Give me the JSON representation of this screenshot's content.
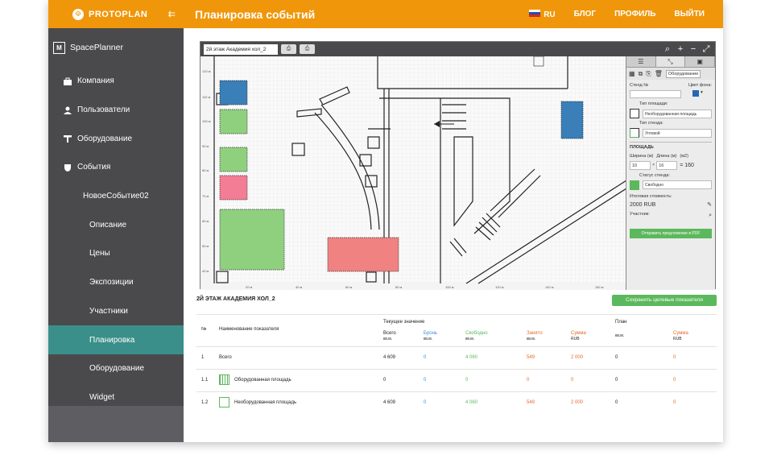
{
  "app": {
    "brand": "PROTOPLAN",
    "collapse_icon": "collapse-arrow-icon",
    "product": "SpacePlanner",
    "product_mark": "M",
    "page_title": "Планировка событий"
  },
  "topnav": {
    "lang": "RU",
    "blog": "БЛОГ",
    "profile": "ПРОФИЛЬ",
    "logout": "ВЫЙТИ"
  },
  "sidebar": {
    "items": [
      {
        "label": "Компания",
        "icon": "briefcase-icon"
      },
      {
        "label": "Пользователи",
        "icon": "user-icon"
      },
      {
        "label": "Оборудование",
        "icon": "tool-icon"
      },
      {
        "label": "События",
        "icon": "shield-icon"
      },
      {
        "label": "НовоеСобытие02"
      },
      {
        "label": "Описание"
      },
      {
        "label": "Цены"
      },
      {
        "label": "Экспозиции"
      },
      {
        "label": "Участники"
      },
      {
        "label": "Планировка",
        "active": true
      },
      {
        "label": "Оборудование"
      },
      {
        "label": "Widget"
      }
    ]
  },
  "planner": {
    "floor_select": "2й этаж Академия хол_2",
    "y_ticks": [
      "120 м",
      "110 м",
      "100 м",
      "90 м",
      "80 м",
      "70 м",
      "60 м",
      "50 м",
      "40 м",
      "30 м"
    ],
    "x_ticks": [
      "20 м",
      "40 м",
      "60 м",
      "80 м",
      "100 м",
      "120 м",
      "140 м",
      "160 м"
    ],
    "panel": {
      "tab_equipment": "Оборудование",
      "stand_label": "Стенд №",
      "bg_color_label": "Цвет фона:",
      "area_type_label": "Тип площади:",
      "area_type_value": "Необорудованная площадь",
      "stand_type_label": "Тип стенда:",
      "stand_type_value": "Угловой",
      "area_section": "ПЛОЩАДЬ",
      "width_label": "Ширина (м)",
      "length_label": "Длина (м)",
      "m2_label": "(м2)",
      "width_value": "10",
      "length_value": "16",
      "area_value": "= 160",
      "status_label": "Статус стенда:",
      "status_value": "Свободно",
      "cost_label": "Итоговая стоимость:",
      "cost_value": "2000 RUB",
      "participant_label": "Участник:",
      "pdf_button": "Отправить предложение в PDF"
    }
  },
  "metrics": {
    "title": "2Й ЭТАЖ АКАДЕМИЯ ХОЛ_2",
    "save_button": "Сохранить целевые показатели",
    "headers": {
      "num": "№",
      "name": "Наименование показателя",
      "current": "Текущее значение",
      "plan": "План",
      "total": "Всего",
      "booked": "Бронь",
      "free": "Свободно",
      "taken": "Занято",
      "sum": "Сумма",
      "unit_m2": "кв.м.",
      "unit_rub": "RUB"
    },
    "rows": [
      {
        "num": "1",
        "name": "Всего",
        "total": "4 609",
        "booked": "0",
        "free": "4 060",
        "taken": "549",
        "sum": "2 000",
        "plan_m2": "0",
        "plan_sum": "0"
      },
      {
        "num": "1.1",
        "name": "Оборудованная площадь",
        "total": "0",
        "booked": "0",
        "free": "0",
        "taken": "0",
        "sum": "0",
        "plan_m2": "0",
        "plan_sum": "0"
      },
      {
        "num": "1.2",
        "name": "Необорудованная площадь",
        "total": "4 609",
        "booked": "0",
        "free": "4 060",
        "taken": "549",
        "sum": "2 000",
        "plan_m2": "0",
        "plan_sum": "0"
      }
    ]
  },
  "colors": {
    "accent": "#f0960a",
    "sidebar": "#4a4a4d",
    "active": "#3a8f8a",
    "green": "#5cb85c",
    "blue": "#3c8dde",
    "orange": "#e8692a"
  }
}
